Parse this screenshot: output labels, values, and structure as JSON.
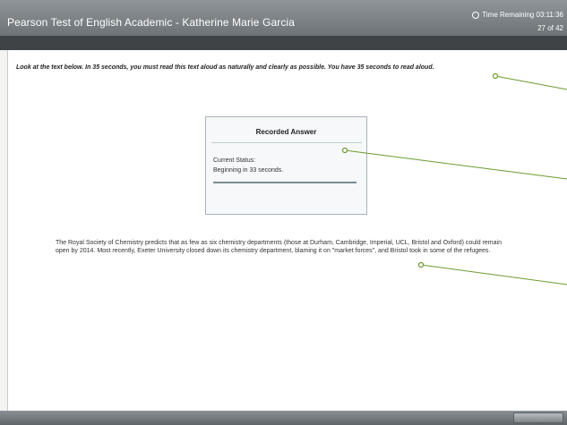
{
  "header": {
    "title": "Pearson Test of English Academic - Katherine Marie Garcia",
    "time_remaining": "Time Remaining 03:11:36",
    "page_counter": "27 of 42"
  },
  "main": {
    "instruction": "Look at the text below. In 35 seconds, you must read this text aloud as naturally and clearly as possible. You have 35 seconds to read aloud.",
    "recorder": {
      "title": "Recorded Answer",
      "status_label": "Current Status:",
      "status_value": "Beginning in 33 seconds.",
      "progress": 0
    },
    "passage": "The Royal Society of Chemistry predicts that as few as six chemistry departments (those at Durham, Cambridge, Imperial, UCL, Bristol and Oxford) could remain open by 2014. Most recently, Exeter University closed down its chemistry department, blaming it on \"market forces\", and Bristol took in some of the refugees."
  },
  "colors": {
    "header_bg": "#7d8387",
    "dark_band": "#3f4346",
    "callout_line": "#6b9a2e"
  },
  "icons": [
    "clock-icon"
  ]
}
